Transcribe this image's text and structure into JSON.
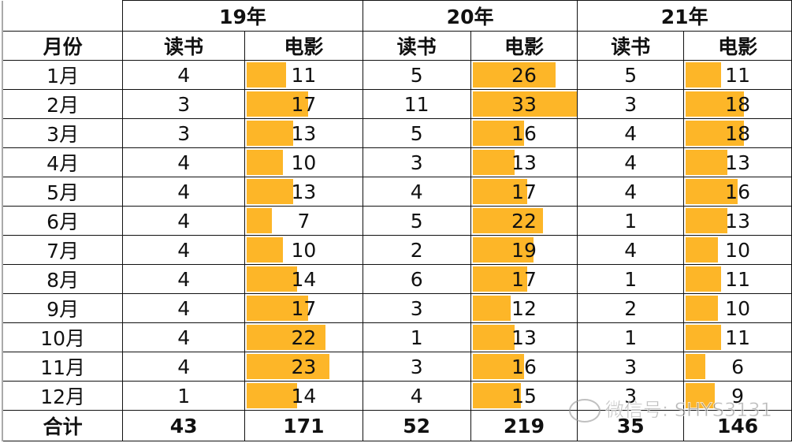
{
  "header": {
    "month_label": "月份",
    "years": [
      "19年",
      "20年",
      "21年"
    ],
    "reading_label": "读书",
    "movie_label": "电影"
  },
  "rows": [
    {
      "month": "1月",
      "v": [
        4,
        11,
        5,
        26,
        5,
        11
      ]
    },
    {
      "month": "2月",
      "v": [
        3,
        17,
        11,
        33,
        3,
        18
      ]
    },
    {
      "month": "3月",
      "v": [
        3,
        13,
        5,
        16,
        4,
        18
      ]
    },
    {
      "month": "4月",
      "v": [
        4,
        10,
        3,
        13,
        4,
        13
      ]
    },
    {
      "month": "5月",
      "v": [
        4,
        13,
        4,
        17,
        4,
        16
      ]
    },
    {
      "month": "6月",
      "v": [
        4,
        7,
        5,
        22,
        1,
        13
      ]
    },
    {
      "month": "7月",
      "v": [
        4,
        10,
        2,
        19,
        4,
        10
      ]
    },
    {
      "month": "8月",
      "v": [
        4,
        14,
        6,
        17,
        1,
        11
      ]
    },
    {
      "month": "9月",
      "v": [
        4,
        17,
        3,
        12,
        2,
        10
      ]
    },
    {
      "month": "10月",
      "v": [
        4,
        22,
        1,
        13,
        1,
        11
      ]
    },
    {
      "month": "11月",
      "v": [
        4,
        23,
        3,
        16,
        3,
        6
      ]
    },
    {
      "month": "12月",
      "v": [
        1,
        14,
        4,
        15,
        3,
        9
      ]
    }
  ],
  "total": {
    "label": "合计",
    "v": [
      43,
      171,
      52,
      219,
      35,
      146
    ]
  },
  "bar_color": "#FDB628",
  "watermark": "微信号: SHYS3131"
}
